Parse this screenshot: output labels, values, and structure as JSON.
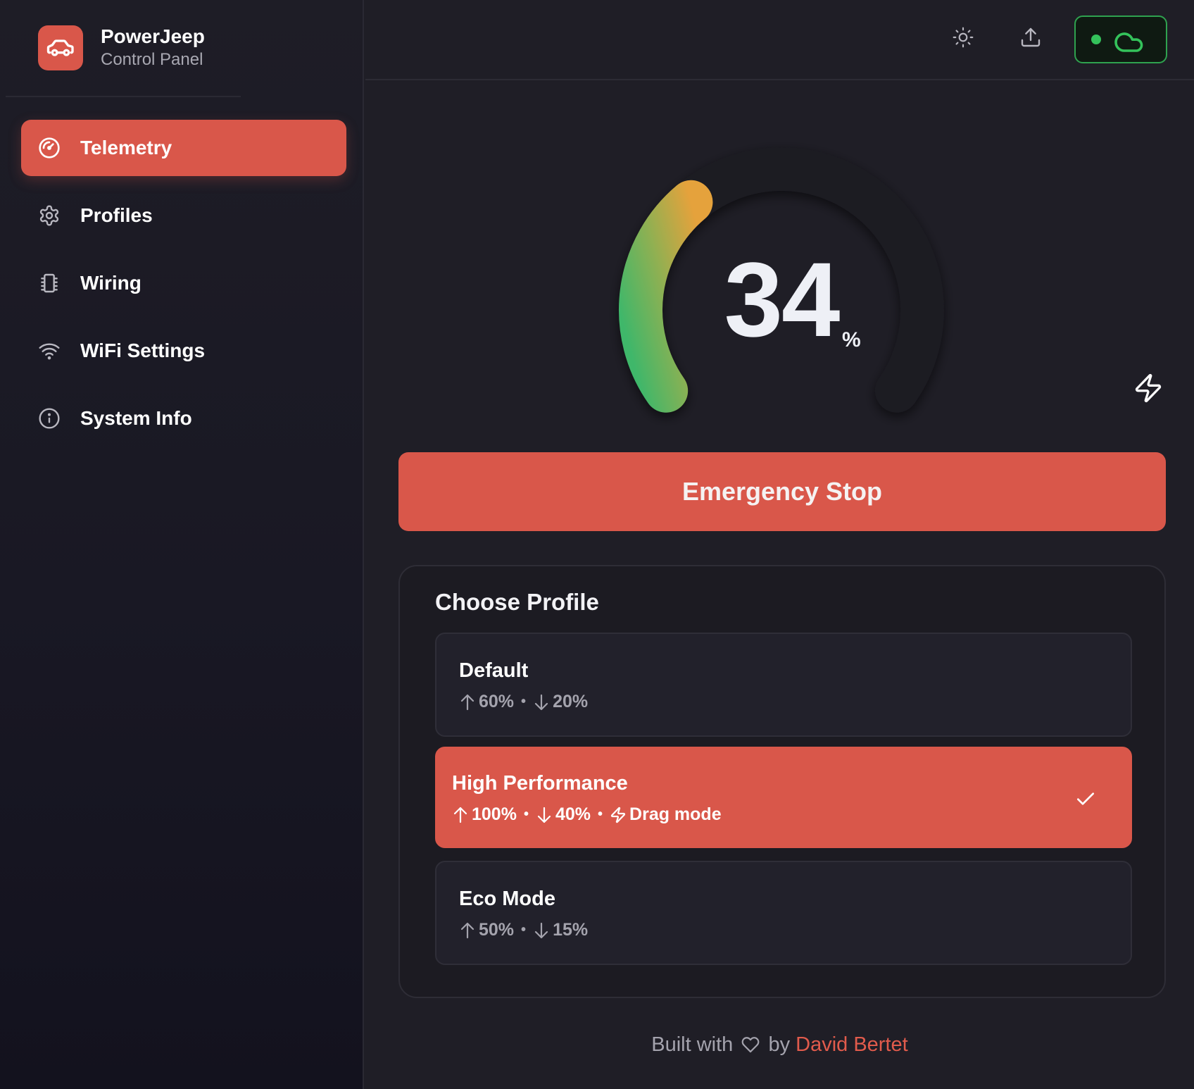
{
  "brand": {
    "name": "PowerJeep",
    "subtitle": "Control Panel",
    "logo_icon": "car-icon"
  },
  "nav": {
    "items": [
      {
        "label": "Telemetry",
        "icon": "gauge-icon",
        "active": true
      },
      {
        "label": "Profiles",
        "icon": "gear-icon",
        "active": false
      },
      {
        "label": "Wiring",
        "icon": "chip-icon",
        "active": false
      },
      {
        "label": "WiFi Settings",
        "icon": "wifi-icon",
        "active": false
      },
      {
        "label": "System Info",
        "icon": "info-icon",
        "active": false
      }
    ]
  },
  "header": {
    "theme_icon": "sun-icon",
    "upload_icon": "upload-icon",
    "cloud_status": {
      "icon": "cloud-icon",
      "connected": true,
      "color": "#34c25b"
    }
  },
  "gauge": {
    "value": "34",
    "unit": "%",
    "fraction": 0.34,
    "boost_icon": "bolt-icon"
  },
  "emergency_stop": {
    "label": "Emergency Stop"
  },
  "profiles": {
    "title": "Choose Profile",
    "options": [
      {
        "name": "Default",
        "up": "60%",
        "sep1": "•",
        "down": "20%",
        "selected": false
      },
      {
        "name": "High Performance",
        "up": "100%",
        "sep1": "•",
        "down": "40%",
        "sep2": "•",
        "extra": "Drag mode",
        "selected": true
      },
      {
        "name": "Eco Mode",
        "up": "50%",
        "sep1": "•",
        "down": "15%",
        "selected": false
      }
    ]
  },
  "footer": {
    "prefix": "Built with",
    "middle": "by",
    "author": "David Bertet"
  },
  "colors": {
    "accent": "#d9574a",
    "background": "#1f1e26",
    "sidebar": "#191824",
    "online": "#34c25b"
  }
}
